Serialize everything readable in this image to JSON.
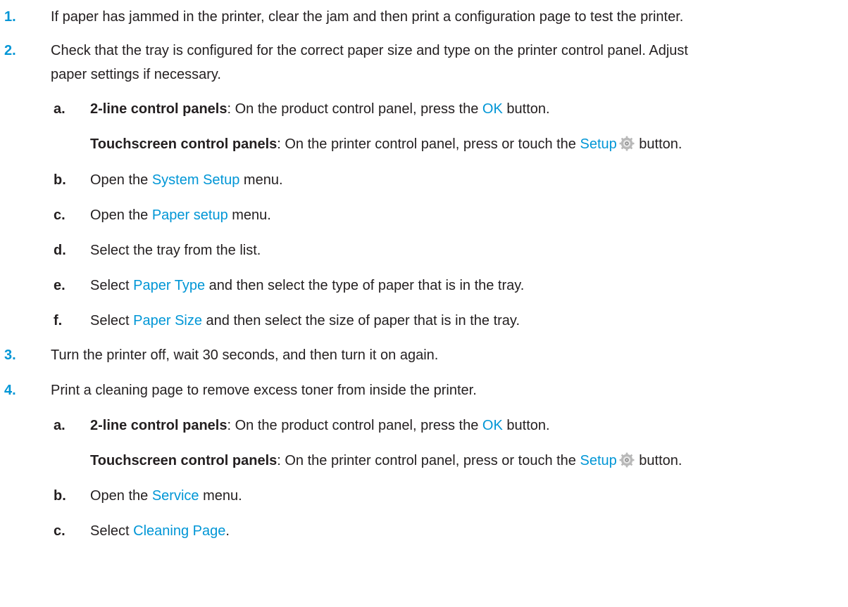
{
  "steps": [
    {
      "number": "1.",
      "text": "If paper has jammed in the printer, clear the jam and then print a configuration page to test the printer."
    },
    {
      "number": "2.",
      "text_line1": "Check that the tray is configured for the correct paper size and type on the printer control panel. Adjust",
      "text_line2": "paper settings if necessary.",
      "substeps": {
        "a": {
          "letter": "a.",
          "two_line_label": "2-line control panels",
          "two_line_text_pre": ": On the product control panel, press the ",
          "two_line_button": "OK",
          "two_line_text_post": " button.",
          "touch_label": "Touchscreen control panels",
          "touch_text_pre": ": On the printer control panel, press or touch the ",
          "touch_button": "Setup",
          "touch_icon": "gear-icon",
          "touch_text_post": " button."
        },
        "b": {
          "letter": "b.",
          "pre": "Open the ",
          "link": "System Setup",
          "post": " menu."
        },
        "c": {
          "letter": "c.",
          "pre": "Open the ",
          "link": "Paper setup",
          "post": " menu."
        },
        "d": {
          "letter": "d.",
          "text": "Select the tray from the list."
        },
        "e": {
          "letter": "e.",
          "pre": "Select ",
          "link": "Paper Type",
          "post": " and then select the type of paper that is in the tray."
        },
        "f": {
          "letter": "f.",
          "pre": "Select ",
          "link": "Paper Size",
          "post": " and then select the size of paper that is in the tray."
        }
      }
    },
    {
      "number": "3.",
      "text": "Turn the printer off, wait 30 seconds, and then turn it on again."
    },
    {
      "number": "4.",
      "text": "Print a cleaning page to remove excess toner from inside the printer.",
      "substeps": {
        "a": {
          "letter": "a.",
          "two_line_label": "2-line control panels",
          "two_line_text_pre": ": On the product control panel, press the ",
          "two_line_button": "OK",
          "two_line_text_post": " button.",
          "touch_label": "Touchscreen control panels",
          "touch_text_pre": ": On the printer control panel, press or touch the ",
          "touch_button": "Setup",
          "touch_icon": "gear-icon",
          "touch_text_post": " button."
        },
        "b": {
          "letter": "b.",
          "pre": "Open the ",
          "link": "Service",
          "post": " menu."
        },
        "c": {
          "letter": "c.",
          "pre": "Select ",
          "link": "Cleaning Page",
          "post": "."
        }
      }
    }
  ],
  "colors": {
    "accent": "#0096d6",
    "text": "#231f20"
  }
}
